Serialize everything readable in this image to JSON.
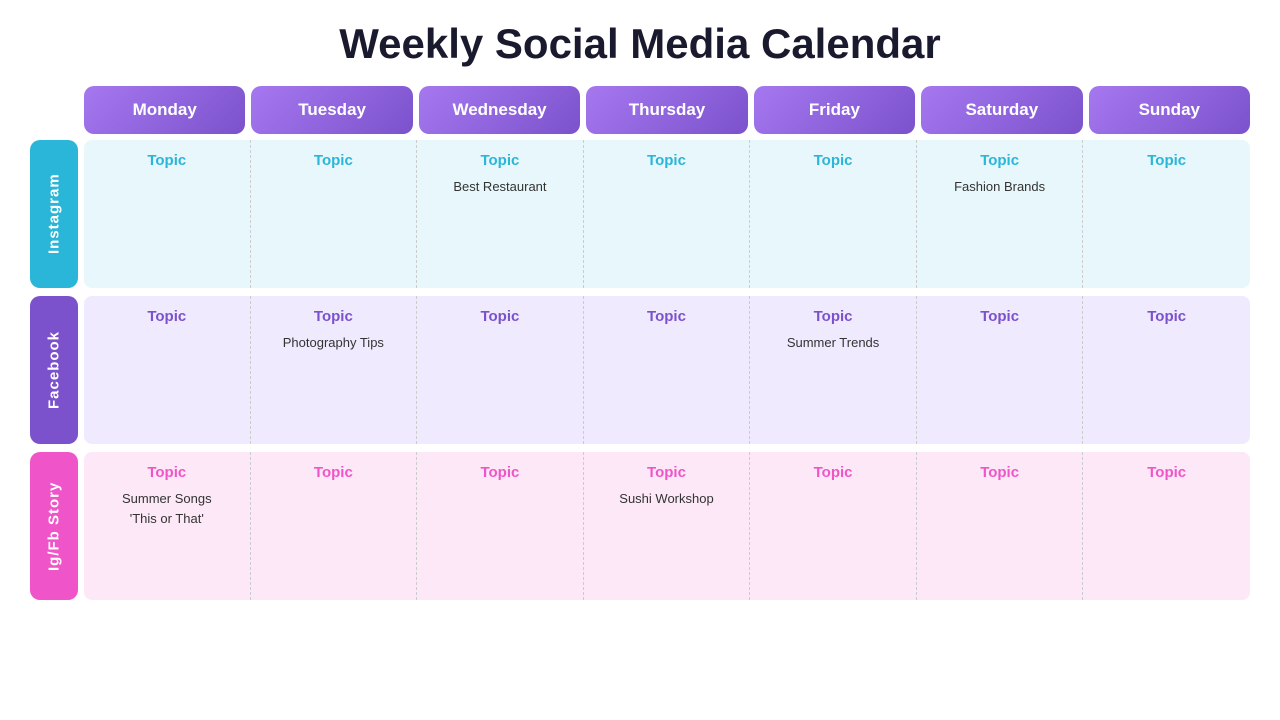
{
  "title": "Weekly Social Media Calendar",
  "days": [
    "Monday",
    "Tuesday",
    "Wednesday",
    "Thursday",
    "Friday",
    "Saturday",
    "Sunday"
  ],
  "rows": [
    {
      "label": "Instagram",
      "key": "instagram",
      "bg": "#e8f7fb",
      "labelBg": "#29b6d8",
      "topicColor": "#29b6d8",
      "cells": [
        {
          "topic": "Topic",
          "content": ""
        },
        {
          "topic": "Topic",
          "content": ""
        },
        {
          "topic": "Topic",
          "content": "Best Restaurant"
        },
        {
          "topic": "Topic",
          "content": ""
        },
        {
          "topic": "Topic",
          "content": ""
        },
        {
          "topic": "Topic",
          "content": "Fashion Brands"
        },
        {
          "topic": "Topic",
          "content": ""
        }
      ]
    },
    {
      "label": "Facebook",
      "key": "facebook",
      "bg": "#f0eaff",
      "labelBg": "#7b52cc",
      "topicColor": "#7b52cc",
      "cells": [
        {
          "topic": "Topic",
          "content": ""
        },
        {
          "topic": "Topic",
          "content": "Photography Tips"
        },
        {
          "topic": "Topic",
          "content": ""
        },
        {
          "topic": "Topic",
          "content": ""
        },
        {
          "topic": "Topic",
          "content": "Summer Trends"
        },
        {
          "topic": "Topic",
          "content": ""
        },
        {
          "topic": "Topic",
          "content": ""
        }
      ]
    },
    {
      "label": "Ig/Fb Story",
      "key": "story",
      "bg": "#fde8f7",
      "labelBg": "#ef55c8",
      "topicColor": "#ef55c8",
      "cells": [
        {
          "topic": "Topic",
          "content": "Summer Songs\n'This or That'"
        },
        {
          "topic": "Topic",
          "content": ""
        },
        {
          "topic": "Topic",
          "content": ""
        },
        {
          "topic": "Topic",
          "content": "Sushi Workshop"
        },
        {
          "topic": "Topic",
          "content": ""
        },
        {
          "topic": "Topic",
          "content": ""
        },
        {
          "topic": "Topic",
          "content": ""
        }
      ]
    }
  ]
}
